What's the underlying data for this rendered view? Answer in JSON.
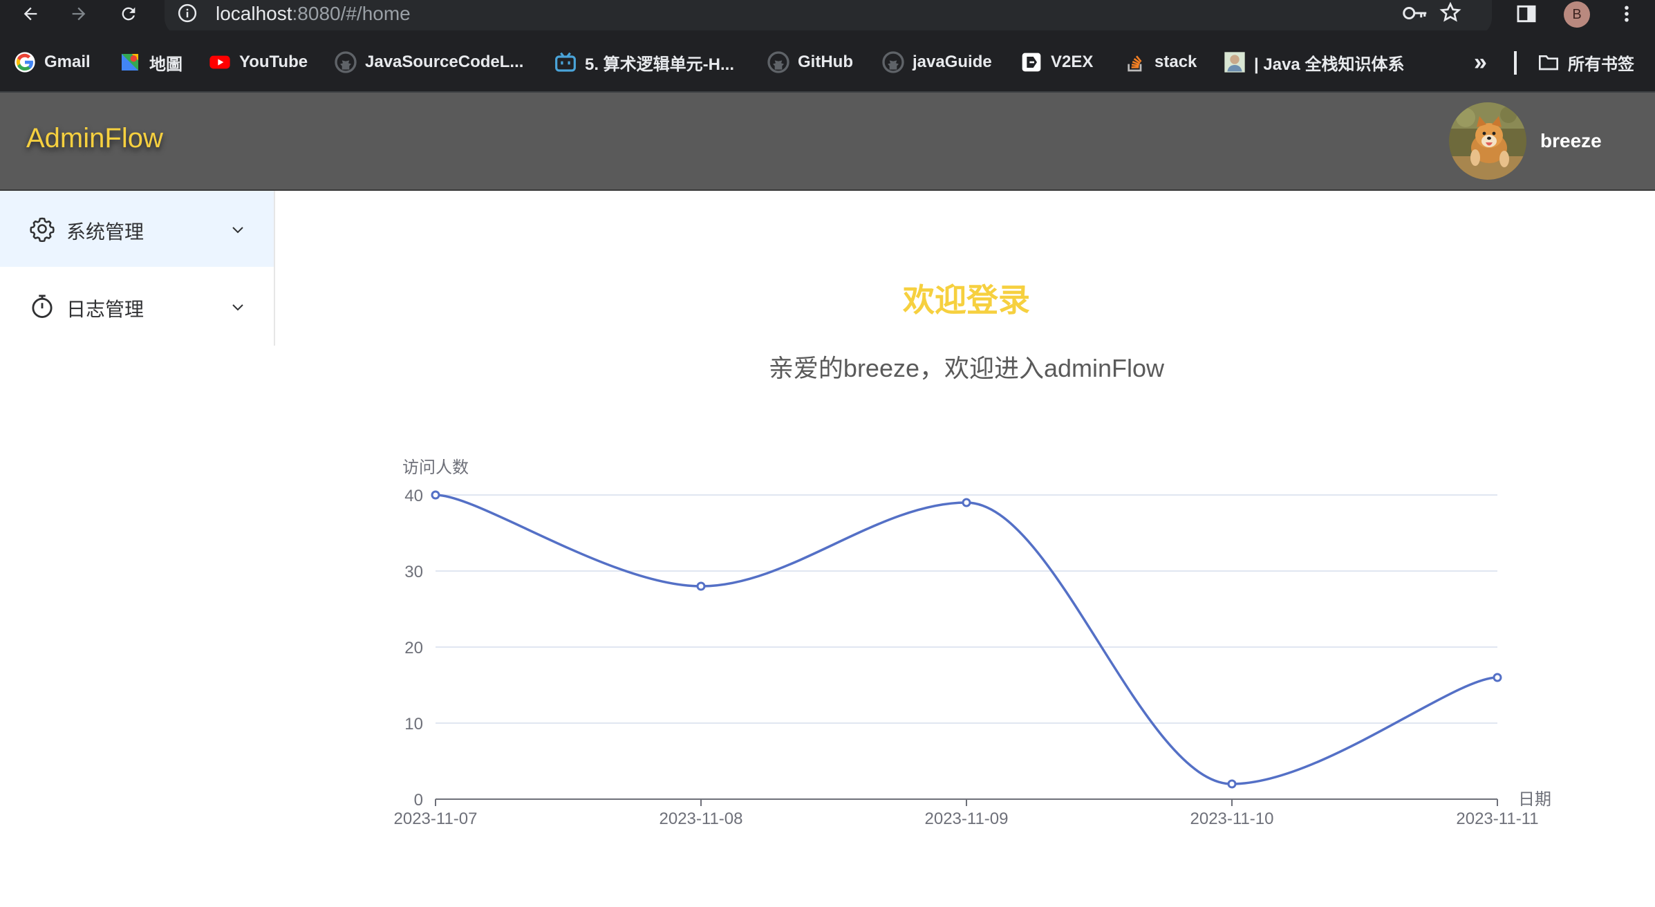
{
  "browser": {
    "url_host": "localhost",
    "url_rest": ":8080/#/home",
    "profile_initial": "B",
    "bookmarks": [
      {
        "label": "Gmail",
        "icon": "gmail-icon"
      },
      {
        "label": "地圖",
        "icon": "maps-icon"
      },
      {
        "label": "YouTube",
        "icon": "youtube-icon"
      },
      {
        "label": "JavaSourceCodeL...",
        "icon": "github-icon"
      },
      {
        "label": "5. 算术逻辑单元-H...",
        "icon": "bilibili-icon"
      },
      {
        "label": "GitHub",
        "icon": "github-icon"
      },
      {
        "label": "javaGuide",
        "icon": "github-icon"
      },
      {
        "label": "V2EX",
        "icon": "v2ex-icon"
      },
      {
        "label": "stack",
        "icon": "stackoverflow-icon"
      },
      {
        "label": "| Java 全栈知识体系",
        "icon": "java-site-icon"
      }
    ],
    "overflow_label": "»",
    "all_bookmarks_label": "所有书签"
  },
  "header": {
    "brand": "AdminFlow",
    "user_name": "breeze"
  },
  "sidebar": {
    "items": [
      {
        "label": "系统管理",
        "icon": "gear-icon",
        "active": true
      },
      {
        "label": "日志管理",
        "icon": "timer-icon",
        "active": false
      }
    ]
  },
  "main": {
    "title": "欢迎登录",
    "subtitle": "亲爱的breeze，欢迎进入adminFlow"
  },
  "colors": {
    "brand": "#f6d03f",
    "header_bg": "#5a5a5a",
    "series": "#5470c6",
    "active_menu_bg": "#ecf5ff"
  },
  "chart_data": {
    "type": "line",
    "smooth": true,
    "title": "",
    "xlabel": "日期",
    "ylabel": "访问人数",
    "categories": [
      "2023-11-07",
      "2023-11-08",
      "2023-11-09",
      "2023-11-10",
      "2023-11-11"
    ],
    "series": [
      {
        "values": [
          40,
          28,
          39,
          2,
          16
        ]
      }
    ],
    "ylim": [
      0,
      40
    ],
    "yticks": [
      0,
      10,
      20,
      30,
      40
    ],
    "grid": true,
    "legend": "none"
  }
}
